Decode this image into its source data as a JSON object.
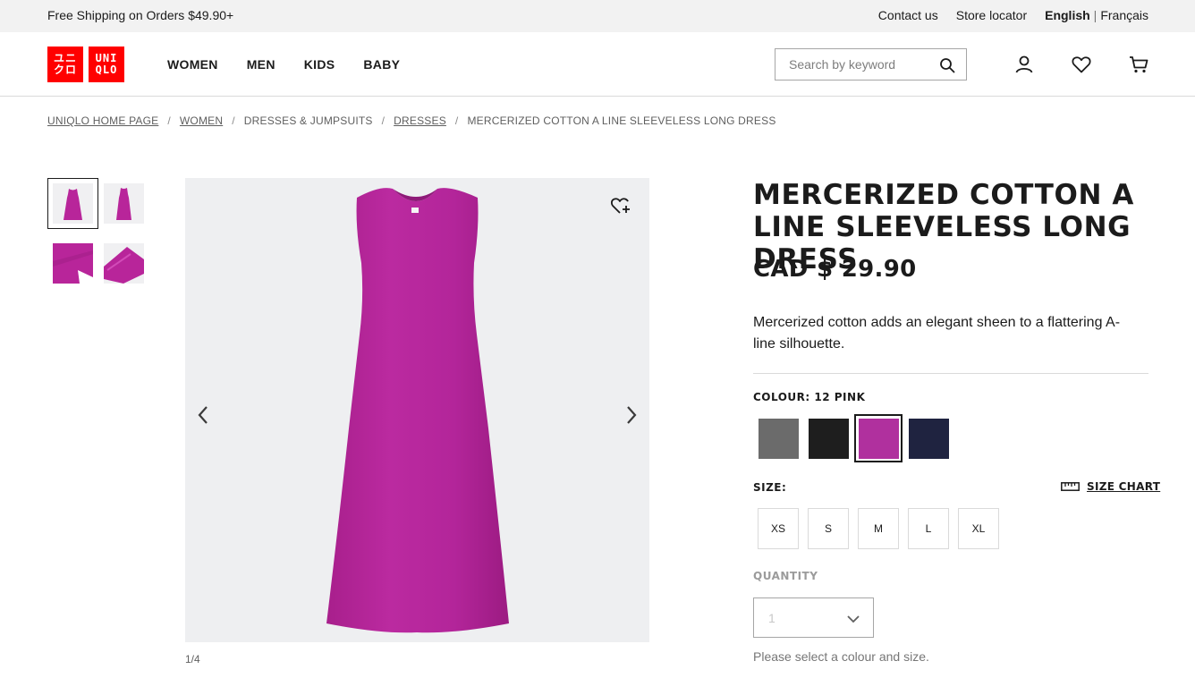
{
  "topbar": {
    "promo": "Free Shipping on Orders $49.90+",
    "contact": "Contact us",
    "store_locator": "Store locator",
    "lang_en": "English",
    "lang_sep": "|",
    "lang_fr": "Français"
  },
  "header": {
    "logo_top_left": "ユニ",
    "logo_bottom_left": "クロ",
    "logo_top_right": "UNI",
    "logo_bottom_right": "QLO",
    "nav": [
      "WOMEN",
      "MEN",
      "KIDS",
      "BABY"
    ],
    "search_placeholder": "Search by keyword",
    "icons": [
      "search-icon",
      "account-icon",
      "wishlist-heart-icon",
      "cart-icon"
    ]
  },
  "breadcrumb": [
    {
      "label": "UNIQLO HOME PAGE",
      "link": true
    },
    {
      "label": "WOMEN",
      "link": true
    },
    {
      "label": "DRESSES & JUMPSUITS",
      "link": false
    },
    {
      "label": "DRESSES",
      "link": true
    },
    {
      "label": "MERCERIZED COTTON A LINE SLEEVELESS LONG DRESS",
      "link": false
    }
  ],
  "breadcrumb_sep": "/",
  "gallery": {
    "counter": "1/4",
    "product_color": "#b8259a",
    "thumbnails": 4,
    "active_thumbnail": 1
  },
  "product": {
    "title": "MERCERIZED COTTON A LINE SLEEVELESS LONG DRESS",
    "price": "CAD $ 29.90",
    "description": "Mercerized cotton adds an elegant sheen to a flattering A-line silhouette.",
    "colour_label": "COLOUR: 12 PINK",
    "colours": [
      {
        "name": "gray",
        "hex": "#6b6b6b"
      },
      {
        "name": "black",
        "hex": "#1e1e1e"
      },
      {
        "name": "pink",
        "hex": "#b0309e"
      },
      {
        "name": "navy",
        "hex": "#1f2340"
      }
    ],
    "selected_colour": 2,
    "size_label": "SIZE:",
    "size_chart": "SIZE CHART",
    "sizes": [
      "XS",
      "S",
      "M",
      "L",
      "XL"
    ],
    "quantity_label": "QUANTITY",
    "quantity_value": "1",
    "note": "Please select a colour and size."
  }
}
